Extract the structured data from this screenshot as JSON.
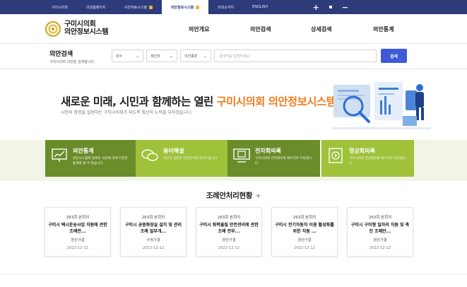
{
  "topbar": {
    "tabs": [
      {
        "label": "구미시의회",
        "active": false,
        "external": false
      },
      {
        "label": "의원홈페이지",
        "active": false,
        "external": false
      },
      {
        "label": "사전자료시스템",
        "active": false,
        "external": true
      },
      {
        "label": "의안정보시스템",
        "active": true,
        "external": true
      },
      {
        "label": "의회소식지",
        "active": false,
        "external": false
      },
      {
        "label": "ENGLISH",
        "active": false,
        "external": false
      }
    ],
    "zoom_in": "+",
    "zoom_out": "−"
  },
  "header": {
    "logo_line1": "구미시의회",
    "logo_line2": "의안정보시스템",
    "seal_text": "구미시의회",
    "nav": [
      "의안개요",
      "의안검색",
      "상세검색",
      "의안통계"
    ]
  },
  "search": {
    "title": "의안검색",
    "subtitle": "구미시의회 의안을 검색합니다.",
    "select1": "대수",
    "select2": "제안자",
    "select3": "의안종류",
    "query_placeholder": "검색어를 입력하세요.",
    "button": "검색"
  },
  "hero": {
    "headline_pre": "새로운 미래, 시민과 함께하는 열린 ",
    "headline_accent": "구미시의회 의안정보시스템",
    "sub": "시민의 참정을 실현하는 구미시의회가 되도록 최선의 노력을 다하겠습니다."
  },
  "quick_menu": [
    {
      "title": "의안통계",
      "desc": "의안시스템에 등록된 의안에 대해 다양한 통계를 볼 수 있습니다.",
      "icon": "chart-board-icon",
      "tone": "dark"
    },
    {
      "title": "용어해설",
      "desc": "의안과 관련된 전문용어를 알려드립니다.",
      "icon": "speech-bubbles-icon",
      "tone": "light"
    },
    {
      "title": "전자회의록",
      "desc": "구미시의회 전자회의록 페이지로 이동합니다.",
      "icon": "monitor-document-icon",
      "tone": "dark"
    },
    {
      "title": "영상회의록",
      "desc": "구미시의회 영상회의록 페이지로 이동합니다.",
      "icon": "video-play-icon",
      "tone": "light"
    }
  ],
  "ordinance_section": {
    "title": "조례안처리현황",
    "more": "+",
    "cards": [
      {
        "session": "263회 본회의",
        "title": "구미시 택시운송사업 지원에 관한 조례안...",
        "status": "원안가결",
        "date": "2022-12-12"
      },
      {
        "session": "263회 본회의",
        "title": "구미시 공중화장실 설치 및 관리 조례 일부개...",
        "status": "수정가결",
        "date": "2022-12-12"
      },
      {
        "session": "263회 본회의",
        "title": "구미시 화학물질 안전관리에 관한 조례 전부...",
        "status": "원안가결",
        "date": "2022-12-12"
      },
      {
        "session": "263회 본회의",
        "title": "구미시 전기자동차 이용 활성화를 위한 지원 ...",
        "status": "원안가결",
        "date": "2022-12-12"
      },
      {
        "session": "263회 본회의",
        "title": "구미시 구미형 일자리 지원 및 촉진 조례안...",
        "status": "원안가결",
        "date": "2022-12-12"
      }
    ]
  },
  "colors": {
    "topbar": "#2d3b7a",
    "accent_orange": "#f47c20",
    "search_button": "#3d5bd6",
    "green_dark": "#6b8c2a",
    "green_light": "#9fc23a"
  }
}
